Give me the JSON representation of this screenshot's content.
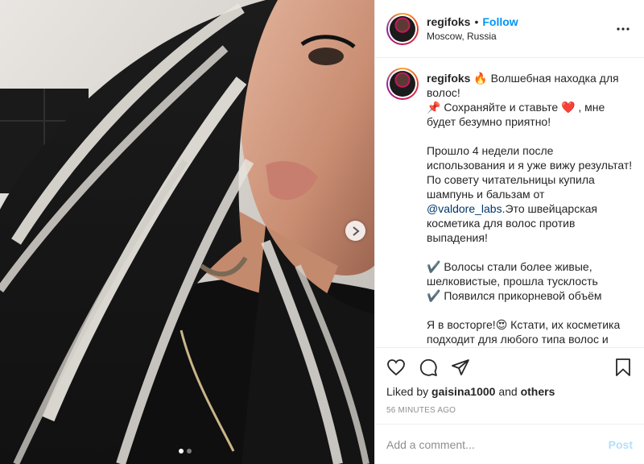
{
  "post": {
    "username": "regifoks",
    "follow_separator": "•",
    "follow_label": "Follow",
    "location": "Moscow, Russia",
    "more_icon": "more-horizontal-icon",
    "carousel": {
      "current": 1,
      "total": 2,
      "next_icon": "chevron-right-icon"
    }
  },
  "caption": {
    "username": "regifoks",
    "text_1": " 🔥 Волшебная находка для волос!\n📌 Сохраняйте и ставьте ❤️ , мне будет безумно приятно!\n\nПрошло 4 недели после использования и я уже вижу результат! По совету читательницы купила шампунь и бальзам от ",
    "mention": "@valdore_labs",
    "text_2": ".Это швейцарская косметика для волос против выпадения!\n\n✔️ Волосы стали более живые, шелковистые, прошла тусклость\n✔️ Появился прикорневой объём\n\nЯ в восторге!😍 Кстати, их косметика подходит для любого типа волос и кожи головы, и даже для окрашенных"
  },
  "actions": {
    "like_icon": "heart-icon",
    "comment_icon": "comment-icon",
    "share_icon": "share-icon",
    "save_icon": "bookmark-icon"
  },
  "likes": {
    "prefix": "Liked by ",
    "user": "gaisina1000",
    "middle": " and ",
    "others": "others"
  },
  "timestamp": "56 MINUTES AGO",
  "comment": {
    "placeholder": "Add a comment...",
    "post_label": "Post"
  },
  "colors": {
    "accent": "#0095f6",
    "post_disabled": "#b2dffc",
    "muted": "#8e8e8e"
  }
}
